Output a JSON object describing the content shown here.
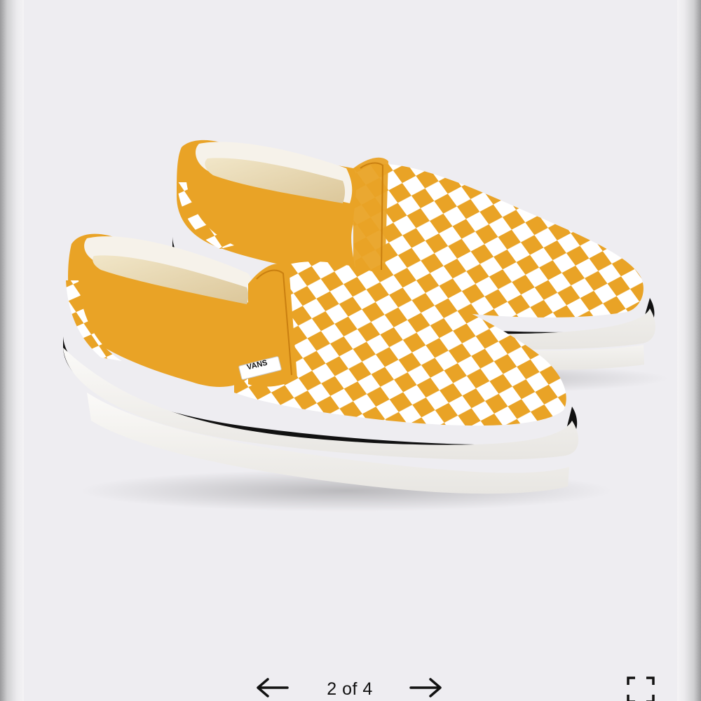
{
  "gallery": {
    "counter_text": "2 of 4",
    "prev_icon": "arrow-left-icon",
    "next_icon": "arrow-right-icon",
    "fullscreen_icon": "expand-corners-icon"
  },
  "product": {
    "logo_text": "VANS",
    "colors": {
      "accent_yellow": "#e9a326",
      "check_white": "#ffffff",
      "sole_white": "#f9f8f6",
      "foxing_stripe": "#1a1a1a",
      "background": "#eeedf1"
    }
  }
}
